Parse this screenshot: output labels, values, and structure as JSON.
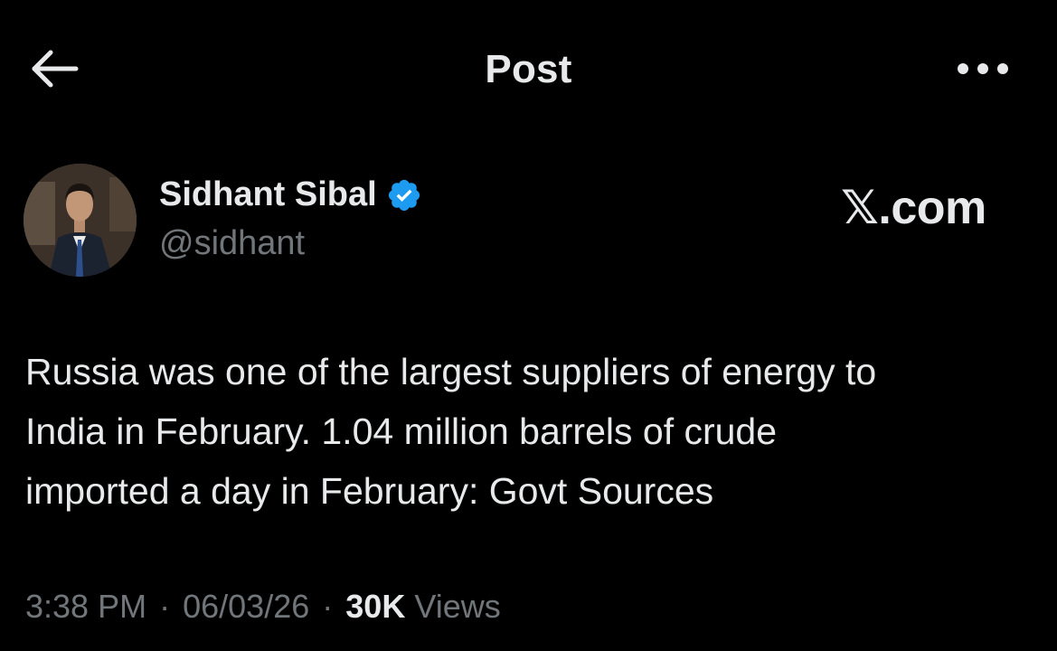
{
  "header": {
    "title": "Post",
    "back_icon": "arrow-left-icon",
    "more_icon": "more-horizontal-icon"
  },
  "author": {
    "display_name": "Sidhant Sibal",
    "handle": "@sidhant",
    "verified_icon": "verified-badge-icon",
    "verified_color": "#1d9bf0"
  },
  "watermark": {
    "text": "𝕏.com"
  },
  "post": {
    "text": "Russia was one of the largest suppliers of energy to\nIndia in February. 1.04 million barrels of crude\nimported a day in February: Govt Sources"
  },
  "meta": {
    "time": "3:38 PM",
    "separator": "·",
    "date": "06/03/26",
    "views_count": "30K",
    "views_label": "Views"
  },
  "colors": {
    "background": "#000000",
    "primary_text": "#e7e9ea",
    "secondary_text": "#71767b",
    "accent": "#1d9bf0"
  }
}
